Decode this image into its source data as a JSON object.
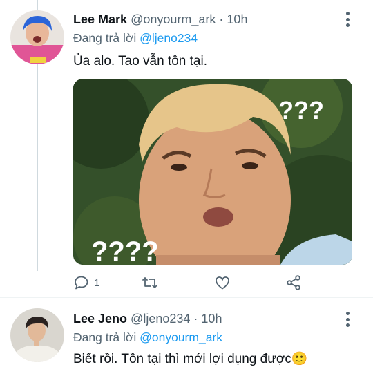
{
  "tweets": [
    {
      "name": "Lee Mark",
      "handle": "@onyourm_ark",
      "separator": "·",
      "time": "10h",
      "reply_prefix": "Đang trả lời",
      "reply_to": "@ljeno234",
      "text": "Ủa alo. Tao vẫn tồn tại.",
      "media_texts": {
        "top_right": "???",
        "bottom_left": "????"
      },
      "reply_count": "1"
    },
    {
      "name": "Lee Jeno",
      "handle": "@ljeno234",
      "separator": "·",
      "time": "10h",
      "reply_prefix": "Đang trả lời",
      "reply_to": "@onyourm_ark",
      "text": "Biết rồi. Tồn tại thì mới lợi dụng được",
      "emoji": "🙂"
    }
  ],
  "colors": {
    "link": "#1d9bf0",
    "muted": "#536471",
    "text": "#0f1419",
    "thread_line": "#cfd9de"
  },
  "icons": [
    "reply-icon",
    "retweet-icon",
    "like-icon",
    "share-icon",
    "more-icon"
  ]
}
